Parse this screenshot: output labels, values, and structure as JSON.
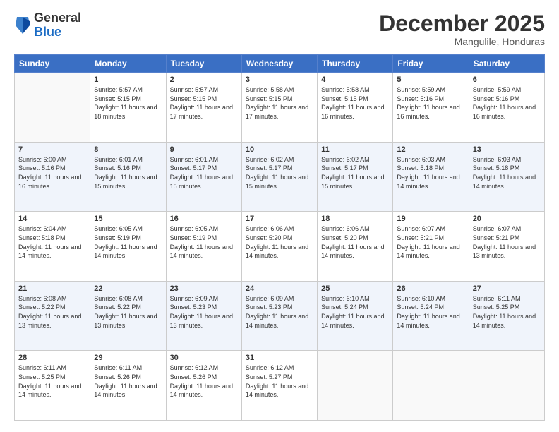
{
  "header": {
    "logo": {
      "general": "General",
      "blue": "Blue"
    },
    "title": "December 2025",
    "location": "Mangulile, Honduras"
  },
  "weekdays": [
    "Sunday",
    "Monday",
    "Tuesday",
    "Wednesday",
    "Thursday",
    "Friday",
    "Saturday"
  ],
  "weeks": [
    [
      {
        "day": "",
        "sunrise": "",
        "sunset": "",
        "daylight": ""
      },
      {
        "day": "1",
        "sunrise": "Sunrise: 5:57 AM",
        "sunset": "Sunset: 5:15 PM",
        "daylight": "Daylight: 11 hours and 18 minutes."
      },
      {
        "day": "2",
        "sunrise": "Sunrise: 5:57 AM",
        "sunset": "Sunset: 5:15 PM",
        "daylight": "Daylight: 11 hours and 17 minutes."
      },
      {
        "day": "3",
        "sunrise": "Sunrise: 5:58 AM",
        "sunset": "Sunset: 5:15 PM",
        "daylight": "Daylight: 11 hours and 17 minutes."
      },
      {
        "day": "4",
        "sunrise": "Sunrise: 5:58 AM",
        "sunset": "Sunset: 5:15 PM",
        "daylight": "Daylight: 11 hours and 16 minutes."
      },
      {
        "day": "5",
        "sunrise": "Sunrise: 5:59 AM",
        "sunset": "Sunset: 5:16 PM",
        "daylight": "Daylight: 11 hours and 16 minutes."
      },
      {
        "day": "6",
        "sunrise": "Sunrise: 5:59 AM",
        "sunset": "Sunset: 5:16 PM",
        "daylight": "Daylight: 11 hours and 16 minutes."
      }
    ],
    [
      {
        "day": "7",
        "sunrise": "Sunrise: 6:00 AM",
        "sunset": "Sunset: 5:16 PM",
        "daylight": "Daylight: 11 hours and 16 minutes."
      },
      {
        "day": "8",
        "sunrise": "Sunrise: 6:01 AM",
        "sunset": "Sunset: 5:16 PM",
        "daylight": "Daylight: 11 hours and 15 minutes."
      },
      {
        "day": "9",
        "sunrise": "Sunrise: 6:01 AM",
        "sunset": "Sunset: 5:17 PM",
        "daylight": "Daylight: 11 hours and 15 minutes."
      },
      {
        "day": "10",
        "sunrise": "Sunrise: 6:02 AM",
        "sunset": "Sunset: 5:17 PM",
        "daylight": "Daylight: 11 hours and 15 minutes."
      },
      {
        "day": "11",
        "sunrise": "Sunrise: 6:02 AM",
        "sunset": "Sunset: 5:17 PM",
        "daylight": "Daylight: 11 hours and 15 minutes."
      },
      {
        "day": "12",
        "sunrise": "Sunrise: 6:03 AM",
        "sunset": "Sunset: 5:18 PM",
        "daylight": "Daylight: 11 hours and 14 minutes."
      },
      {
        "day": "13",
        "sunrise": "Sunrise: 6:03 AM",
        "sunset": "Sunset: 5:18 PM",
        "daylight": "Daylight: 11 hours and 14 minutes."
      }
    ],
    [
      {
        "day": "14",
        "sunrise": "Sunrise: 6:04 AM",
        "sunset": "Sunset: 5:18 PM",
        "daylight": "Daylight: 11 hours and 14 minutes."
      },
      {
        "day": "15",
        "sunrise": "Sunrise: 6:05 AM",
        "sunset": "Sunset: 5:19 PM",
        "daylight": "Daylight: 11 hours and 14 minutes."
      },
      {
        "day": "16",
        "sunrise": "Sunrise: 6:05 AM",
        "sunset": "Sunset: 5:19 PM",
        "daylight": "Daylight: 11 hours and 14 minutes."
      },
      {
        "day": "17",
        "sunrise": "Sunrise: 6:06 AM",
        "sunset": "Sunset: 5:20 PM",
        "daylight": "Daylight: 11 hours and 14 minutes."
      },
      {
        "day": "18",
        "sunrise": "Sunrise: 6:06 AM",
        "sunset": "Sunset: 5:20 PM",
        "daylight": "Daylight: 11 hours and 14 minutes."
      },
      {
        "day": "19",
        "sunrise": "Sunrise: 6:07 AM",
        "sunset": "Sunset: 5:21 PM",
        "daylight": "Daylight: 11 hours and 14 minutes."
      },
      {
        "day": "20",
        "sunrise": "Sunrise: 6:07 AM",
        "sunset": "Sunset: 5:21 PM",
        "daylight": "Daylight: 11 hours and 13 minutes."
      }
    ],
    [
      {
        "day": "21",
        "sunrise": "Sunrise: 6:08 AM",
        "sunset": "Sunset: 5:22 PM",
        "daylight": "Daylight: 11 hours and 13 minutes."
      },
      {
        "day": "22",
        "sunrise": "Sunrise: 6:08 AM",
        "sunset": "Sunset: 5:22 PM",
        "daylight": "Daylight: 11 hours and 13 minutes."
      },
      {
        "day": "23",
        "sunrise": "Sunrise: 6:09 AM",
        "sunset": "Sunset: 5:23 PM",
        "daylight": "Daylight: 11 hours and 13 minutes."
      },
      {
        "day": "24",
        "sunrise": "Sunrise: 6:09 AM",
        "sunset": "Sunset: 5:23 PM",
        "daylight": "Daylight: 11 hours and 14 minutes."
      },
      {
        "day": "25",
        "sunrise": "Sunrise: 6:10 AM",
        "sunset": "Sunset: 5:24 PM",
        "daylight": "Daylight: 11 hours and 14 minutes."
      },
      {
        "day": "26",
        "sunrise": "Sunrise: 6:10 AM",
        "sunset": "Sunset: 5:24 PM",
        "daylight": "Daylight: 11 hours and 14 minutes."
      },
      {
        "day": "27",
        "sunrise": "Sunrise: 6:11 AM",
        "sunset": "Sunset: 5:25 PM",
        "daylight": "Daylight: 11 hours and 14 minutes."
      }
    ],
    [
      {
        "day": "28",
        "sunrise": "Sunrise: 6:11 AM",
        "sunset": "Sunset: 5:25 PM",
        "daylight": "Daylight: 11 hours and 14 minutes."
      },
      {
        "day": "29",
        "sunrise": "Sunrise: 6:11 AM",
        "sunset": "Sunset: 5:26 PM",
        "daylight": "Daylight: 11 hours and 14 minutes."
      },
      {
        "day": "30",
        "sunrise": "Sunrise: 6:12 AM",
        "sunset": "Sunset: 5:26 PM",
        "daylight": "Daylight: 11 hours and 14 minutes."
      },
      {
        "day": "31",
        "sunrise": "Sunrise: 6:12 AM",
        "sunset": "Sunset: 5:27 PM",
        "daylight": "Daylight: 11 hours and 14 minutes."
      },
      {
        "day": "",
        "sunrise": "",
        "sunset": "",
        "daylight": ""
      },
      {
        "day": "",
        "sunrise": "",
        "sunset": "",
        "daylight": ""
      },
      {
        "day": "",
        "sunrise": "",
        "sunset": "",
        "daylight": ""
      }
    ]
  ]
}
